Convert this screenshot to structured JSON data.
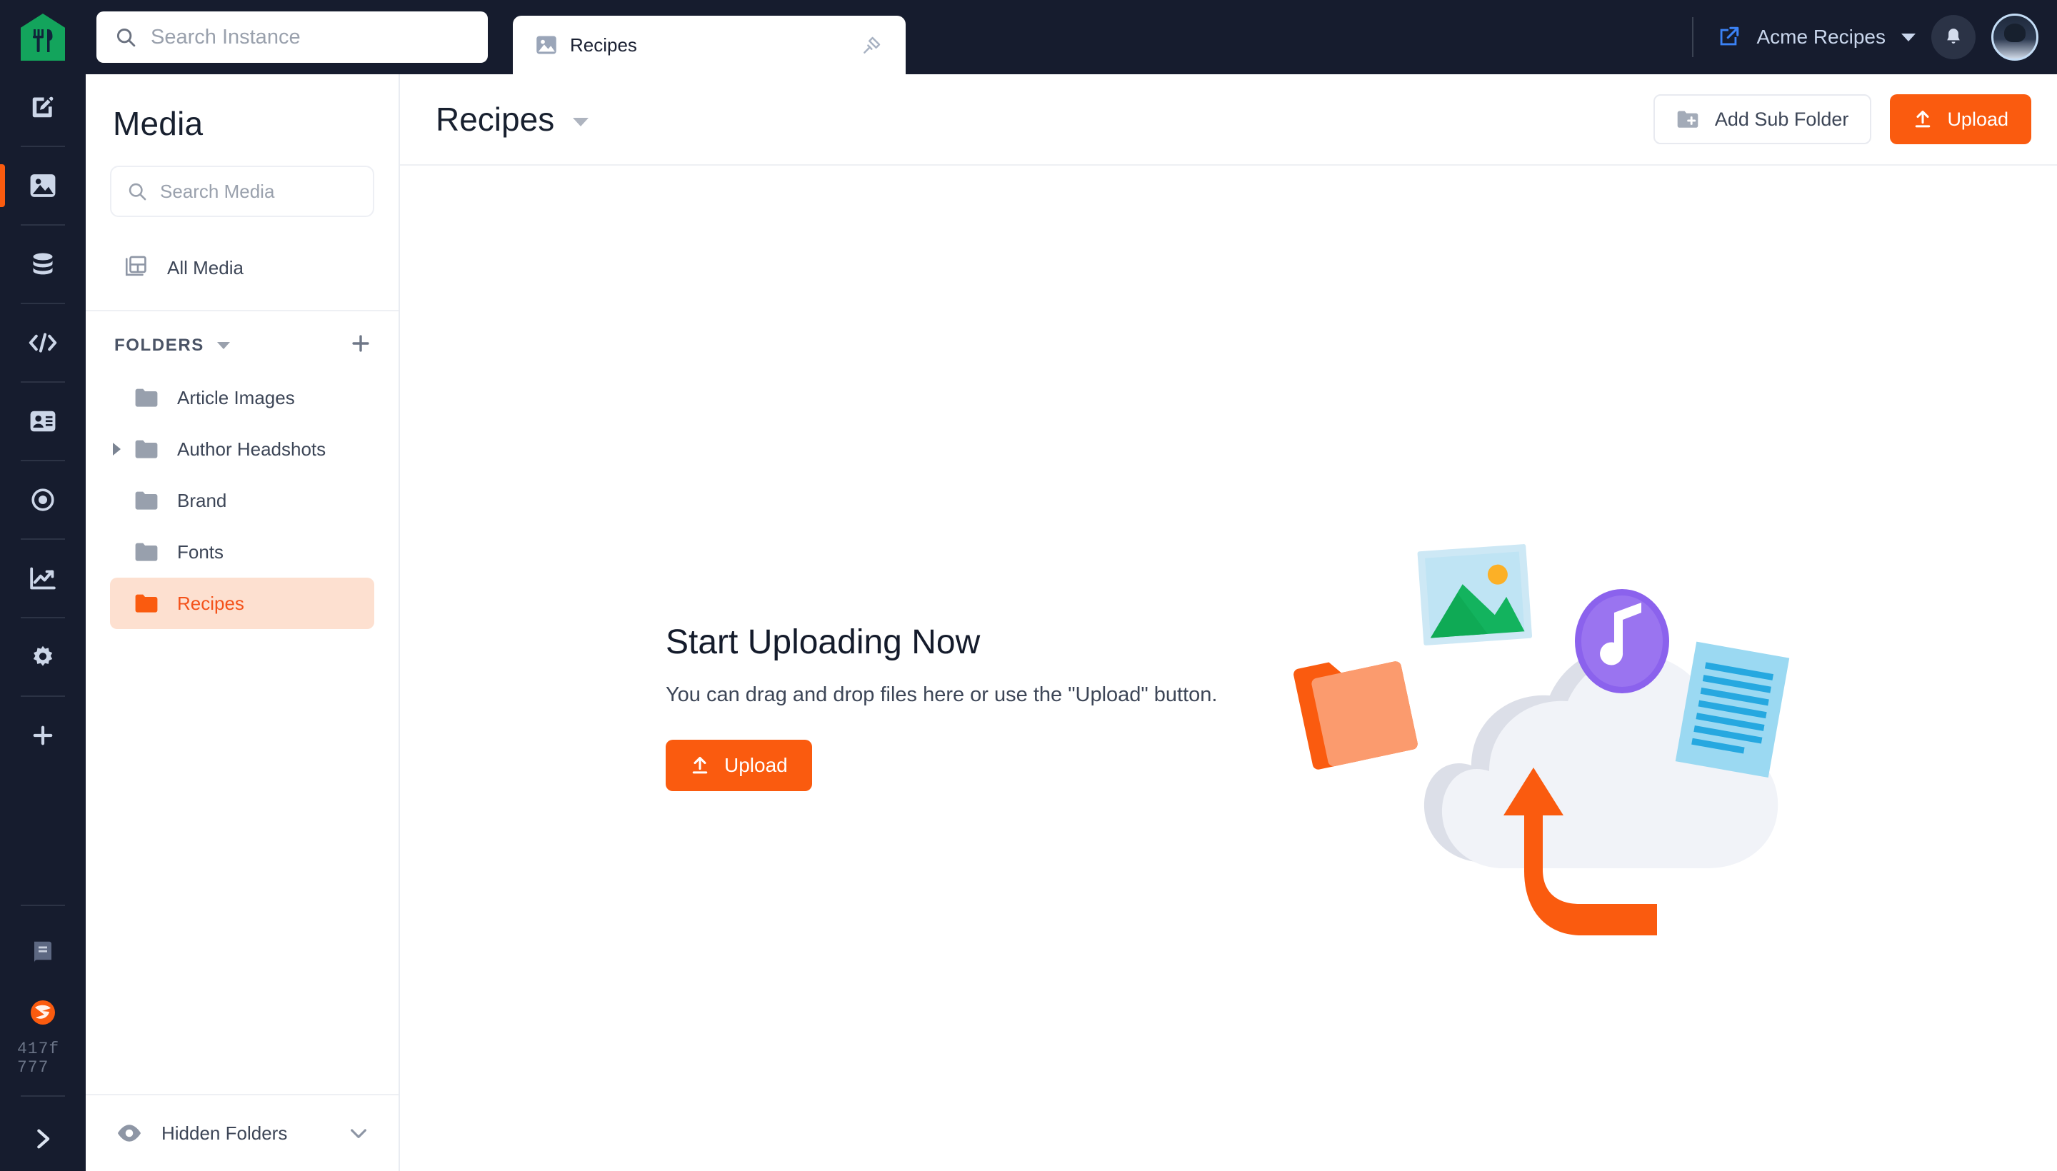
{
  "topbar": {
    "logo_name": "restaurant-logo",
    "search": {
      "placeholder": "Search Instance",
      "value": ""
    },
    "instance_name": "Acme Recipes",
    "notifications_label": "Notifications",
    "avatar_label": "User Avatar"
  },
  "tab": {
    "label": "Recipes",
    "icon": "image-icon",
    "pin_label": "Pin tab"
  },
  "rail": {
    "items": [
      {
        "name": "content-icon",
        "label": "Content",
        "active": false
      },
      {
        "name": "media-icon",
        "label": "Media",
        "active": true
      },
      {
        "name": "database-icon",
        "label": "Data",
        "active": false
      },
      {
        "name": "code-icon",
        "label": "Code",
        "active": false
      },
      {
        "name": "id-card-icon",
        "label": "Profiles",
        "active": false
      },
      {
        "name": "target-icon",
        "label": "Targeting",
        "active": false
      },
      {
        "name": "analytics-icon",
        "label": "Analytics",
        "active": false
      },
      {
        "name": "gear-icon",
        "label": "Settings",
        "active": false
      },
      {
        "name": "plus-icon",
        "label": "Add",
        "active": false
      }
    ],
    "bottom": {
      "docs_label": "Documentation",
      "brand_label": "Brand",
      "version_line1": "417f",
      "version_line2": "777",
      "expand_label": "Expand menu"
    }
  },
  "sidebar": {
    "title": "Media",
    "search": {
      "placeholder": "Search Media",
      "value": ""
    },
    "all_media_label": "All Media",
    "folders_header": "FOLDERS",
    "add_folder_label": "Add folder",
    "folders": [
      {
        "label": "Article Images",
        "expandable": false,
        "selected": false
      },
      {
        "label": "Author Headshots",
        "expandable": true,
        "selected": false
      },
      {
        "label": "Brand",
        "expandable": false,
        "selected": false
      },
      {
        "label": "Fonts",
        "expandable": false,
        "selected": false
      },
      {
        "label": "Recipes",
        "expandable": false,
        "selected": true
      }
    ],
    "hidden_folders_label": "Hidden Folders"
  },
  "main": {
    "page_title": "Recipes",
    "add_sub_folder_label": "Add Sub Folder",
    "upload_label": "Upload",
    "empty": {
      "title": "Start Uploading Now",
      "subtitle": "You can drag and drop files here or use the \"Upload\" button.",
      "upload_label": "Upload"
    }
  },
  "colors": {
    "accent": "#fa5b0f",
    "dark": "#161c2e",
    "selected_bg": "#fde0d0",
    "logo_green": "#13a45c"
  }
}
